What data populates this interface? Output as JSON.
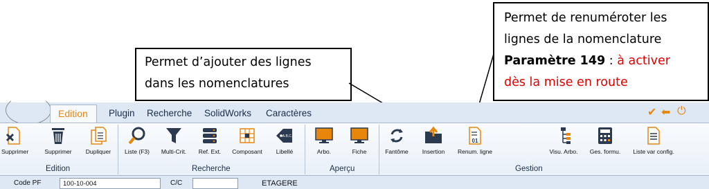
{
  "callouts": {
    "left": {
      "line1": "Permet d’ajouter des lignes",
      "line2": "dans les nomenclatures"
    },
    "right": {
      "line1": "Permet de renuméroter les",
      "line2": "lignes de la nomenclature",
      "param_bold": "Paramètre 149",
      "param_sep": " : ",
      "param_red": "à activer",
      "line4_red": "dès la mise en route"
    }
  },
  "tabs": [
    "Edition",
    "Plugin",
    "Recherche",
    "SolidWorks",
    "Caractères"
  ],
  "quick_access": {
    "check": "✔",
    "back": "⬅",
    "power": "⏻"
  },
  "buttons": {
    "supprimer1": "Supprimer",
    "supprimer2": "Supprimer",
    "dupliquer": "Dupliquer",
    "liste": "Liste (F3)",
    "multicrit": "Multi-Crit.",
    "refext": "Ref. Ext.",
    "composant": "Composant",
    "libelle": "Libellé",
    "arbo": "Arbo.",
    "fiche": "Fiche",
    "fantome": "Fantôme",
    "insertion": "Insertion",
    "renum": "Renum. ligne",
    "visu": "Visu. Arbo.",
    "gesformu": "Ges. formu.",
    "listevar": "Liste var config."
  },
  "groups": {
    "edition": "Edition",
    "recherche": "Recherche",
    "apercu": "Aperçu",
    "gestion": "Gestion"
  },
  "icons": {
    "tag_text": "A.B.C.",
    "renum_digits": "01"
  },
  "form": {
    "code_label": "Code PF",
    "code_value": "100-10-004",
    "cc_label": "C/C",
    "cc_value": "",
    "designation": "ETAGERE"
  },
  "colors": {
    "accent_orange": "#e8860c",
    "ribbon_bg": "#dde8f4",
    "annotation_red": "#e00000"
  }
}
